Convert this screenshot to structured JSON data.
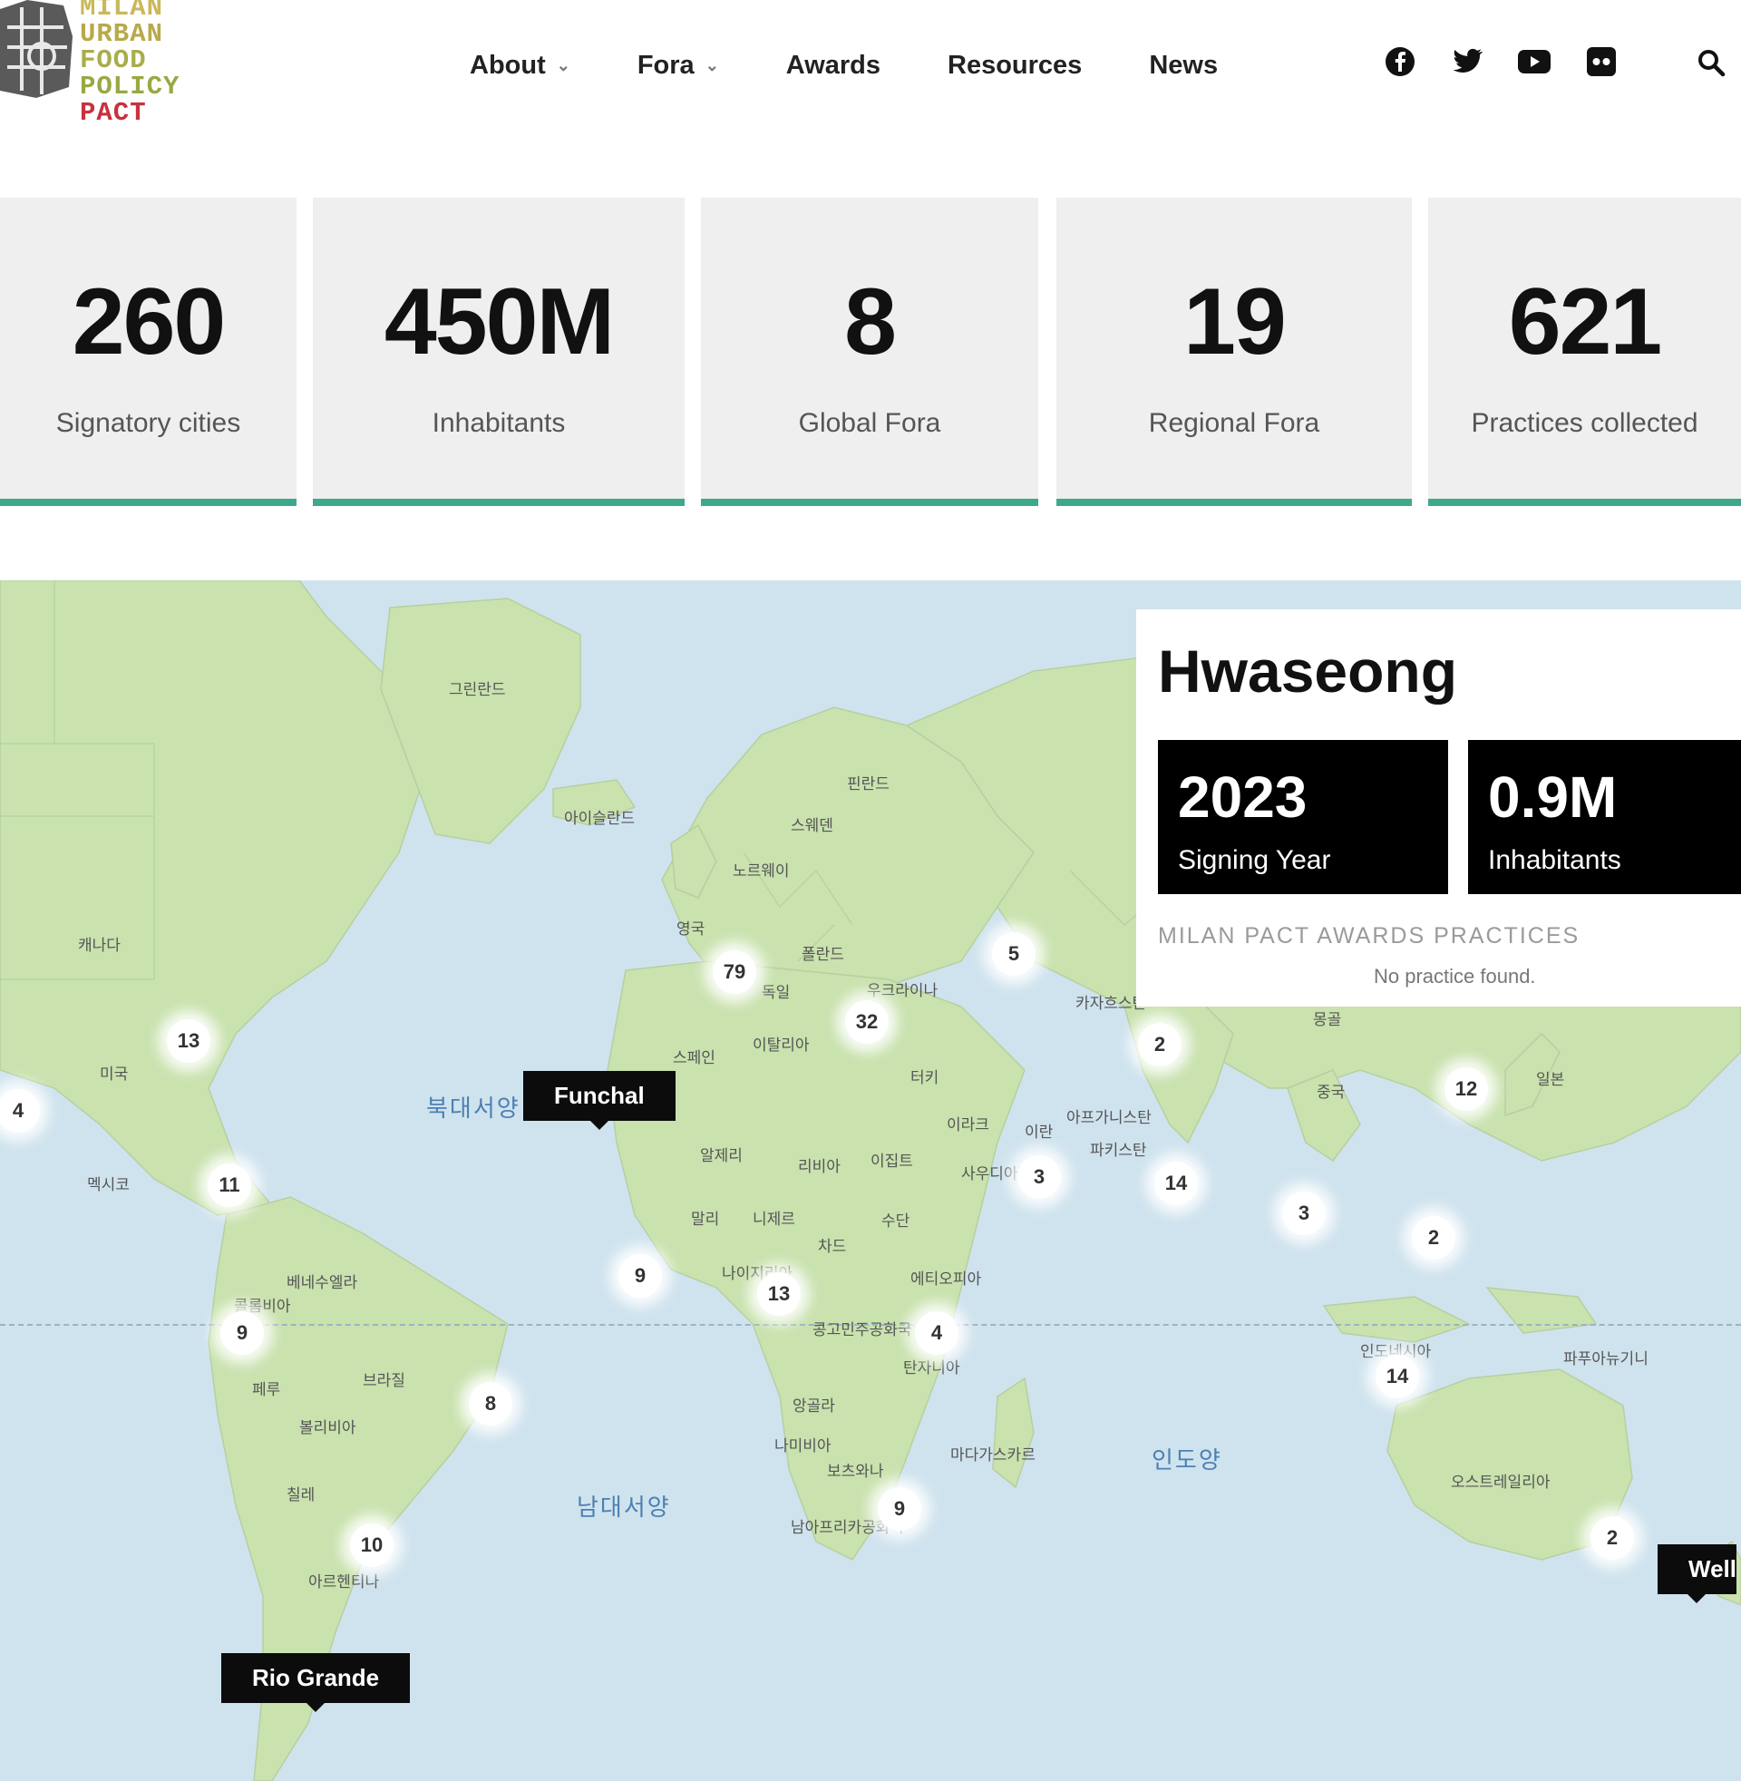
{
  "header": {
    "logo": {
      "lines": [
        {
          "text": "MILAN",
          "color": "#c9b85a"
        },
        {
          "text": "URBAN",
          "color": "#b8a94a"
        },
        {
          "text": "FOOD",
          "color": "#a9ad4a"
        },
        {
          "text": "POLICY",
          "color": "#9aa843"
        },
        {
          "text": "PACT",
          "color": "#c8313e"
        }
      ]
    },
    "nav": [
      {
        "label": "About",
        "has_dropdown": true
      },
      {
        "label": "Fora",
        "has_dropdown": true
      },
      {
        "label": "Awards",
        "has_dropdown": false
      },
      {
        "label": "Resources",
        "has_dropdown": false
      },
      {
        "label": "News",
        "has_dropdown": false
      }
    ],
    "social_icons": [
      "facebook-icon",
      "twitter-icon",
      "youtube-icon",
      "flickr-icon"
    ],
    "search_icon": "search-icon"
  },
  "stats": [
    {
      "value": "260",
      "label": "Signatory cities"
    },
    {
      "value": "450M",
      "label": "Inhabitants"
    },
    {
      "value": "8",
      "label": "Global Fora"
    },
    {
      "value": "19",
      "label": "Regional Fora"
    },
    {
      "value": "621",
      "label": "Practices collected"
    }
  ],
  "colors": {
    "accent": "#3ea88d",
    "land": "#c9e2ae",
    "water": "#cfe3ee",
    "tooltip": "#0c0c0c"
  },
  "map": {
    "clusters": [
      "79",
      "32",
      "5",
      "13",
      "4",
      "11",
      "2",
      "12",
      "3",
      "14",
      "3",
      "2",
      "9",
      "13",
      "4",
      "9",
      "8",
      "10",
      "14",
      "9",
      "2"
    ],
    "tooltips": [
      "Funchal",
      "Rio Grande",
      "Well"
    ],
    "oceans": [
      "북대서양",
      "남대서양",
      "인도양"
    ],
    "places": [
      "그린란드",
      "아이슬란드",
      "핀란드",
      "스웨덴",
      "노르웨이",
      "영국",
      "폴란드",
      "독일",
      "우크라이나",
      "캐나다",
      "미국",
      "멕시코",
      "스페인",
      "이탈리아",
      "알제리",
      "리비아",
      "이집트",
      "터키",
      "이라크",
      "이란",
      "아프가니스탄",
      "파키스탄",
      "카자흐스탄",
      "몽골",
      "중국",
      "일본",
      "말리",
      "니제르",
      "차드",
      "수단",
      "사우디아라비아",
      "나이지리아",
      "에티오피아",
      "베네수엘라",
      "콜롬비아",
      "페루",
      "브라질",
      "볼리비아",
      "칠레",
      "아르헨티나",
      "콩고민주공화국",
      "탄자니아",
      "앙골라",
      "나미비아",
      "보츠와나",
      "마다가스카르",
      "남아프리카공화국",
      "인도네시아",
      "파푸아뉴기니",
      "오스트레일리아"
    ]
  },
  "panel": {
    "city": "Hwaseong",
    "signing_year": {
      "value": "2023",
      "label": "Signing Year"
    },
    "inhabitants": {
      "value": "0.9M",
      "label": "Inhabitants"
    },
    "section_title": "MILAN PACT AWARDS PRACTICES",
    "empty_text": "No practice found."
  }
}
